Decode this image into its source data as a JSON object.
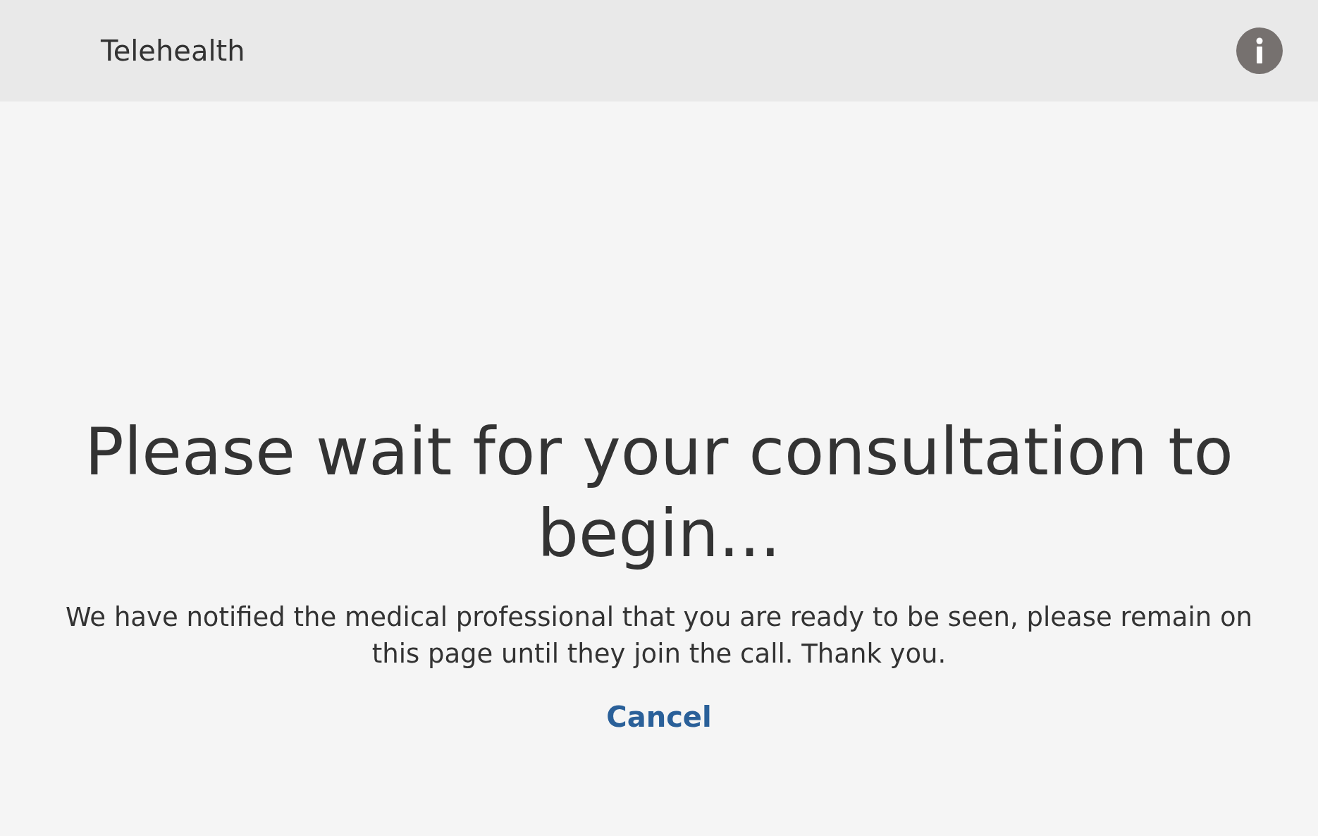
{
  "header": {
    "title": "Telehealth"
  },
  "main": {
    "heading": "Please wait for your consultation to begin...",
    "message": "We have notified the medical professional that you are ready to be seen, please remain on this page until they join the call. Thank you.",
    "cancel_link": "Cancel"
  }
}
